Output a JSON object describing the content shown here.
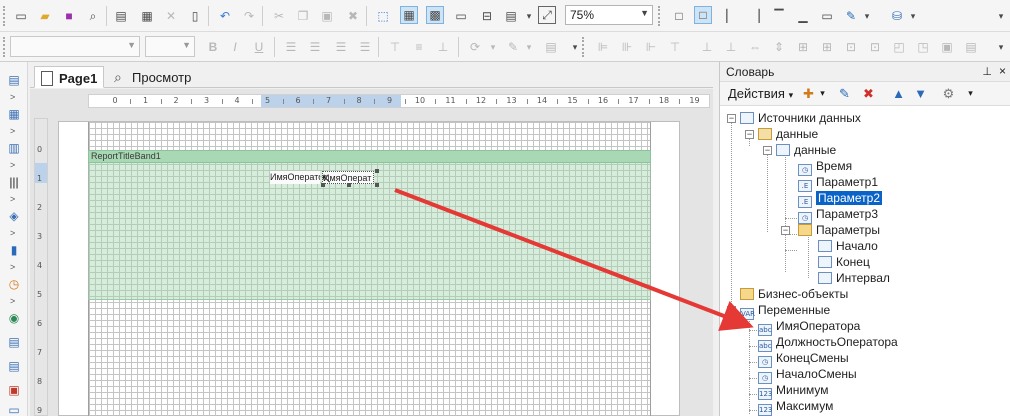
{
  "toolbar": {
    "zoom_value": "75%"
  },
  "tabs": [
    {
      "label": "Page1"
    },
    {
      "label": "Просмотр"
    }
  ],
  "ruler": {
    "h_ticks": [
      "0",
      "1",
      "2",
      "3",
      "4",
      "5",
      "6",
      "7",
      "8",
      "9",
      "10",
      "11",
      "12",
      "13",
      "14",
      "15",
      "16",
      "17",
      "18",
      "19"
    ],
    "v_ticks": [
      "0",
      "1",
      "2",
      "3",
      "4",
      "5",
      "6",
      "7",
      "8",
      "9"
    ]
  },
  "report": {
    "band_title": "ReportTitleBand1",
    "field_a": "ИмяОператора",
    "field_b": "ИмяОперат"
  },
  "dictionary": {
    "title": "Словарь",
    "pin_glyph": "⊥",
    "close_glyph": "×",
    "actions_label": "Действия",
    "tree": [
      {
        "label": "Источники данных",
        "icon": "datasource-icon"
      },
      {
        "label": "данные",
        "icon": "database-icon"
      },
      {
        "label": "данные",
        "icon": "table-icon"
      },
      {
        "label": "Время",
        "icon": "clock-icon"
      },
      {
        "label": "Параметр1",
        "icon": "parameter-icon"
      },
      {
        "label": "Параметр2",
        "icon": "parameter-icon",
        "selected": true
      },
      {
        "label": "Параметр3",
        "icon": "parameter-icon"
      },
      {
        "label": "Параметры",
        "icon": "folder-icon"
      },
      {
        "label": "Начало",
        "icon": "parameter-icon"
      },
      {
        "label": "Конец",
        "icon": "parameter-icon"
      },
      {
        "label": "Интервал",
        "icon": "parameter-icon"
      },
      {
        "label": "Бизнес-объекты",
        "icon": "business-objects-icon"
      },
      {
        "label": "Переменные",
        "icon": "variables-icon"
      },
      {
        "label": "ИмяОператора",
        "icon": "string-variable-icon"
      },
      {
        "label": "ДолжностьОператора",
        "icon": "string-variable-icon"
      },
      {
        "label": "КонецСмены",
        "icon": "time-variable-icon"
      },
      {
        "label": "НачалоСмены",
        "icon": "time-variable-icon"
      },
      {
        "label": "Минимум",
        "icon": "number-variable-icon"
      },
      {
        "label": "Максимум",
        "icon": "number-variable-icon"
      }
    ]
  },
  "icon_glyphs": {
    "abc": "abc",
    "num": "123",
    "var": "VAR",
    "param": ".E"
  },
  "colors": {
    "band": "#a8d8b4",
    "selection": "#0a64c8",
    "arrow": "#e53935"
  }
}
